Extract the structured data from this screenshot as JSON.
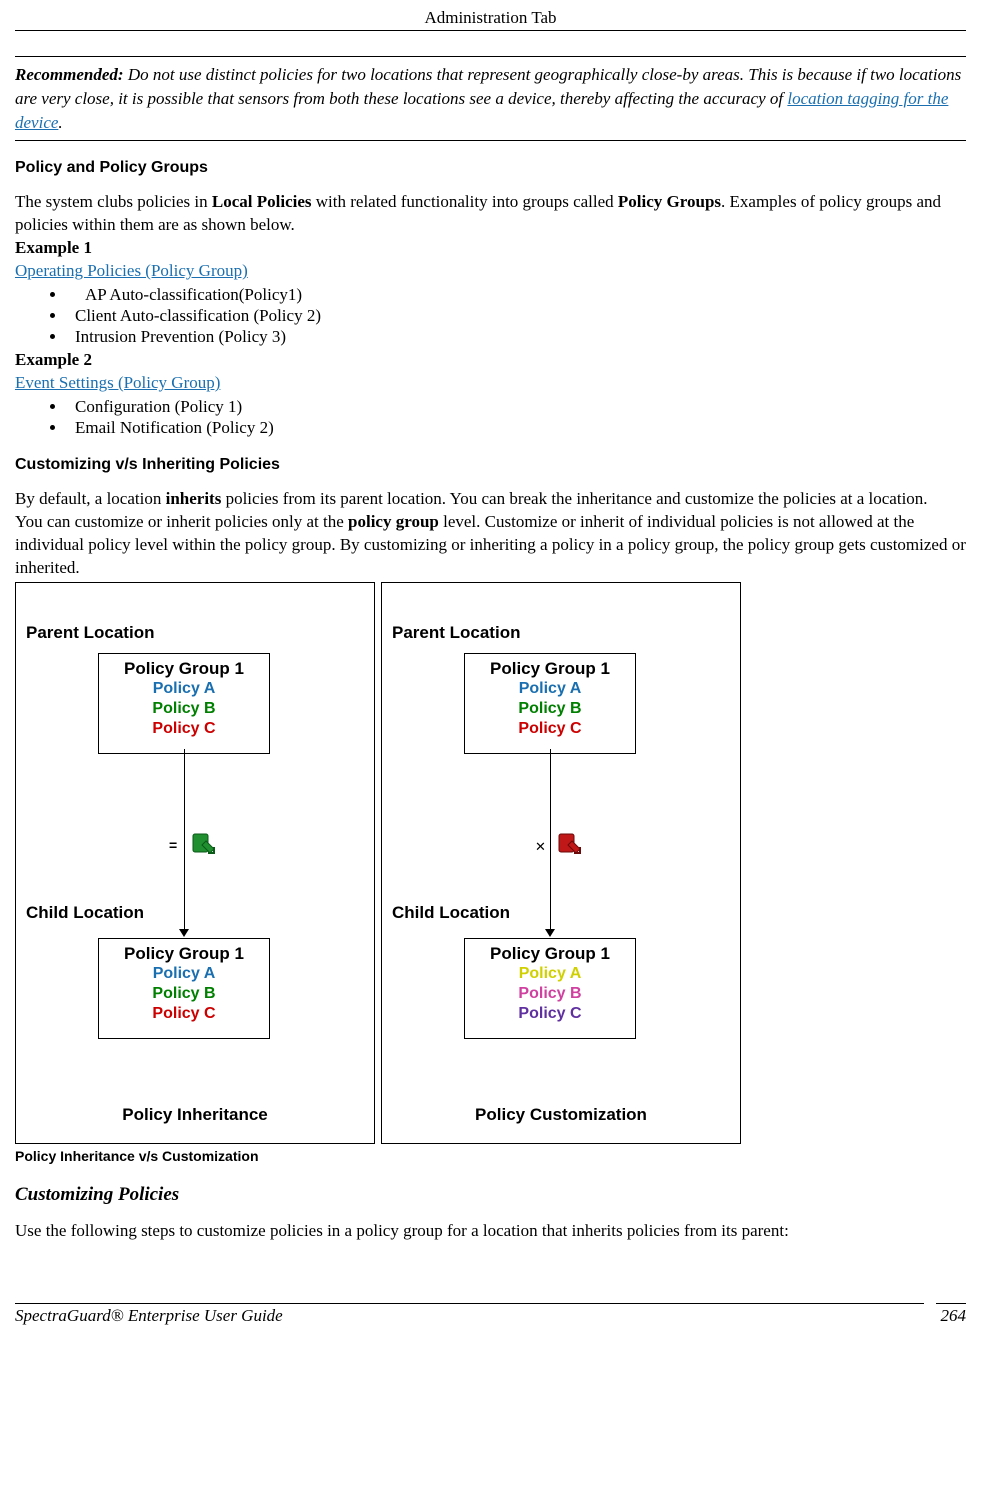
{
  "header": {
    "title": "Administration Tab"
  },
  "callout": {
    "label": "Recommended:",
    "text_before": " Do not use distinct policies for two locations that represent geographically close-by areas. This is because if two locations are very close, it is possible that sensors from both these locations see a device, thereby affecting the accuracy of ",
    "link_text": "location tagging for the device",
    "text_after": "."
  },
  "section1": {
    "heading": "Policy and Policy Groups",
    "intro_before": "The system clubs policies in ",
    "bold1": "Local Policies",
    "intro_mid": " with related functionality into groups called ",
    "bold2": "Policy Groups",
    "intro_after": ". Examples of policy groups and policies within them are as shown below.",
    "example1_label": "Example 1",
    "example1_link": "Operating Policies (Policy Group)",
    "example1_items": [
      " AP Auto-classification(Policy1)",
      "Client Auto-classification (Policy 2)",
      "Intrusion Prevention (Policy 3)"
    ],
    "example2_label": "Example 2",
    "example2_link": "Event Settings (Policy Group)",
    "example2_items": [
      "Configuration (Policy 1)",
      "Email Notification (Policy 2)"
    ]
  },
  "section2": {
    "heading": "Customizing v/s Inheriting Policies",
    "para1_before": "By default, a location ",
    "para1_bold": "inherits",
    "para1_after": " policies from its parent location. You can break the inheritance and customize the policies at a location.",
    "para2_before": "You can customize or inherit policies only at the ",
    "para2_bold": "policy group",
    "para2_after": " level. Customize or inherit of individual policies is not allowed at the individual policy level within the policy group. By customizing or inheriting a policy in a policy group, the policy group gets customized or inherited."
  },
  "diagram": {
    "panel1": {
      "parent_label": "Parent Location",
      "child_label": "Child Location",
      "group1_title": "Policy Group 1",
      "group2_title": "Policy Group 1",
      "policyA": "Policy A",
      "policyB": "Policy B",
      "policyC": "Policy C",
      "group2_policyA": "Policy A",
      "group2_policyB": "Policy B",
      "group2_policyC": "Policy C",
      "caption": "Policy Inheritance",
      "colors": {
        "a1": "#1a6fb0",
        "b1": "#008000",
        "c1": "#cc0000",
        "a2": "#1a6fb0",
        "b2": "#008000",
        "c2": "#cc0000"
      }
    },
    "panel2": {
      "parent_label": "Parent Location",
      "child_label": "Child Location",
      "group1_title": "Policy Group 1",
      "group2_title": "Policy Group 1",
      "policyA": "Policy A",
      "policyB": "Policy B",
      "policyC": "Policy C",
      "group2_policyA": "Policy A",
      "group2_policyB": "Policy B",
      "group2_policyC": "Policy C",
      "caption": "Policy Customization",
      "colors": {
        "a1": "#1a6fb0",
        "b1": "#008000",
        "c1": "#cc0000",
        "a2": "#d0d000",
        "b2": "#d040a0",
        "c2": "#6030a0"
      }
    },
    "figure_caption": "Policy Inheritance v/s Customization"
  },
  "section3": {
    "heading": "Customizing Policies",
    "text": "Use the following steps to customize policies in a policy group for a location that inherits policies from its parent:"
  },
  "footer": {
    "left": "SpectraGuard®  Enterprise User Guide",
    "right": "264"
  }
}
